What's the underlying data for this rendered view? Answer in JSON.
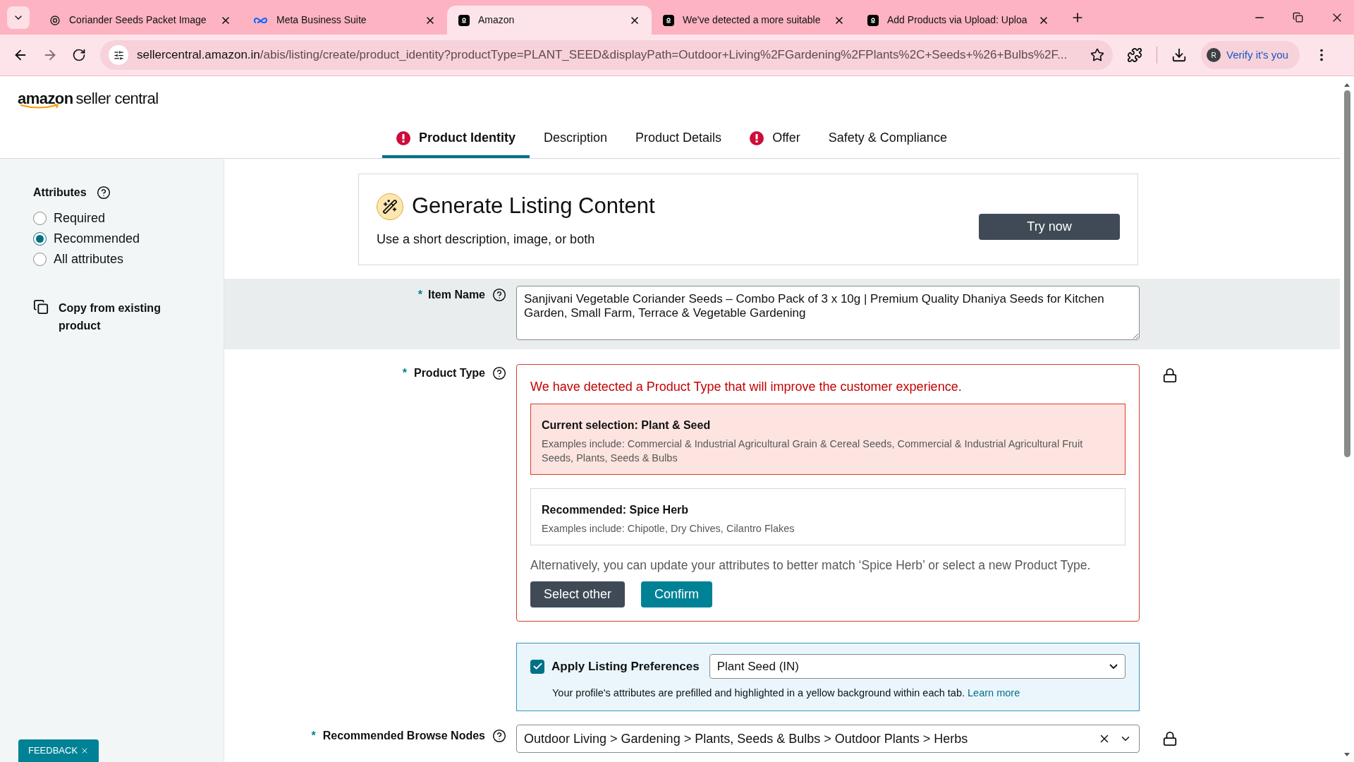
{
  "browser": {
    "tabs": [
      {
        "title": "Coriander Seeds Packet Image",
        "selected": false
      },
      {
        "title": "Meta Business Suite",
        "selected": false
      },
      {
        "title": "Amazon",
        "selected": true
      },
      {
        "title": "We've detected a more suitable",
        "selected": false
      },
      {
        "title": "Add Products via Upload: Uploa",
        "selected": false
      }
    ],
    "url_host": "sellercentral.amazon.in",
    "url_path": "/abis/listing/create/product_identity?productType=PLANT_SEED&displayPath=Outdoor+Living%2FGardening%2FPlants%2C+Seeds+%26+Bulbs%2F...",
    "profile_initial": "R",
    "profile_label": "Verify it's you"
  },
  "header": {
    "logo_brand": "amazon",
    "logo_product": "seller central"
  },
  "nav_tabs": [
    {
      "label": "Product Identity",
      "selected": true,
      "alert": true
    },
    {
      "label": "Description",
      "selected": false,
      "alert": false
    },
    {
      "label": "Product Details",
      "selected": false,
      "alert": false
    },
    {
      "label": "Offer",
      "selected": false,
      "alert": true
    },
    {
      "label": "Safety & Compliance",
      "selected": false,
      "alert": false
    }
  ],
  "sidebar": {
    "title": "Attributes",
    "options": [
      {
        "label": "Required",
        "selected": false
      },
      {
        "label": "Recommended",
        "selected": true
      },
      {
        "label": "All attributes",
        "selected": false
      }
    ],
    "copy_link": "Copy from existing product"
  },
  "generate_card": {
    "title": "Generate Listing Content",
    "subtitle": "Use a short description, image, or both",
    "button": "Try now"
  },
  "item_name": {
    "required_mark": "*",
    "label": "Item Name",
    "value": "Sanjivani Vegetable Coriander Seeds – Combo Pack of 3 x 10g | Premium Quality Dhaniya Seeds for Kitchen Garden, Small Farm, Terrace & Vegetable Gardening"
  },
  "product_type": {
    "required_mark": "*",
    "label": "Product Type",
    "warning": "We have detected a Product Type that will improve the customer experience.",
    "options": [
      {
        "title": "Current selection: Plant & Seed",
        "examples": "Examples include: Commercial & Industrial Agricultural Grain & Cereal Seeds, Commercial & Industrial Agricultural Fruit Seeds, Plants, Seeds & Bulbs",
        "kind": "current"
      },
      {
        "title": "Recommended: Spice Herb",
        "examples": "Examples include: Chipotle, Dry Chives, Cilantro Flakes",
        "kind": "recommended"
      }
    ],
    "note": "Alternatively, you can update your attributes to better match ‘Spice Herb’ or select a new Product Type.",
    "buttons": [
      {
        "label": "Select other",
        "kind": "secondary"
      },
      {
        "label": "Confirm",
        "kind": "primary"
      }
    ]
  },
  "listing_preferences": {
    "label": "Apply Listing Preferences",
    "checked": true,
    "value": "Plant Seed (IN)",
    "note": "Your profile's attributes are prefilled and highlighted in a yellow background within each tab.",
    "link": "Learn more"
  },
  "browse_nodes": {
    "required_mark": "*",
    "label": "Recommended Browse Nodes",
    "value": "Outdoor Living > Gardening > Plants, Seeds & Bulbs > Outdoor Plants > Herbs"
  },
  "feedback": {
    "label": "FEEDBACK"
  }
}
